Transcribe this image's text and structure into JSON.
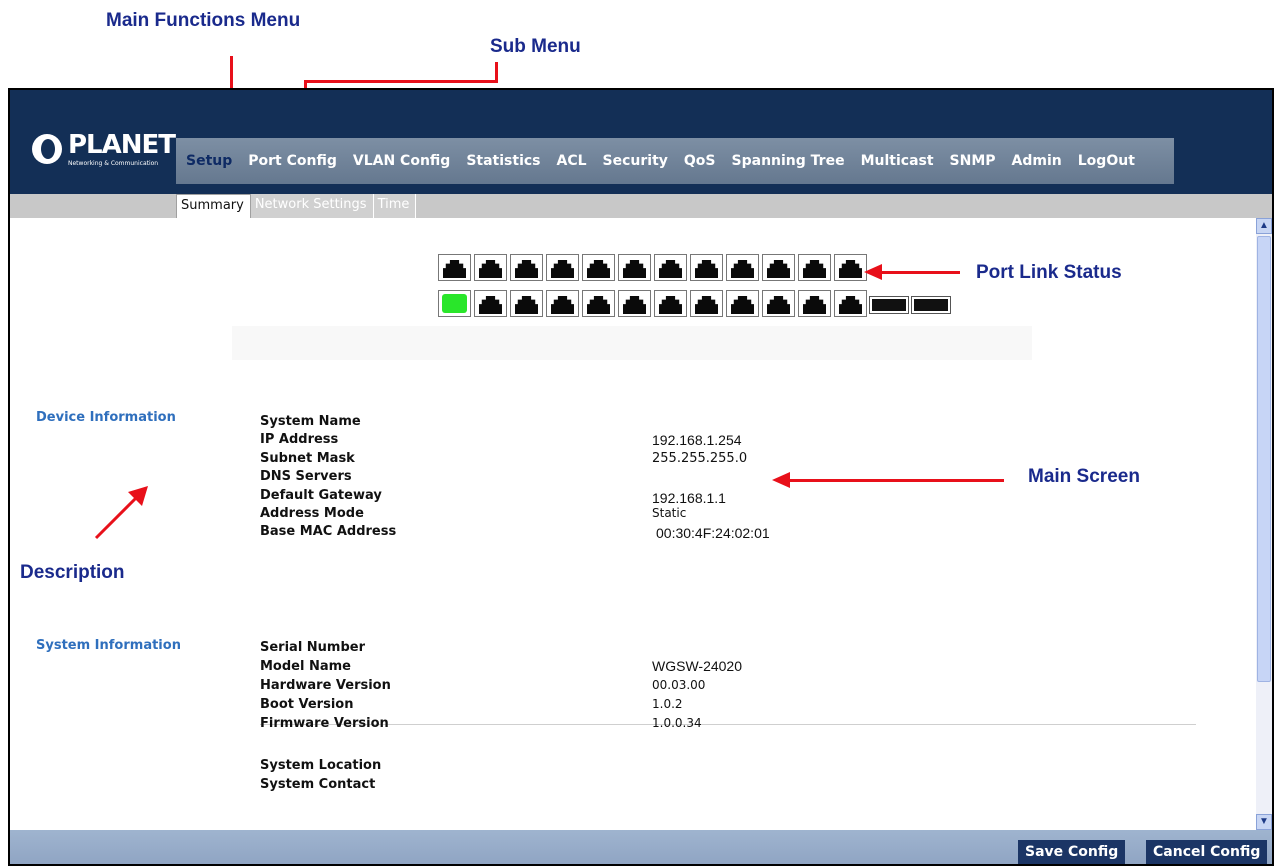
{
  "annotations": {
    "main_functions_menu": "Main Functions Menu",
    "sub_menu": "Sub Menu",
    "port_link_status": "Port Link Status",
    "main_screen": "Main Screen",
    "description": "Description"
  },
  "logo": {
    "name": "PLANET",
    "tagline": "Networking & Communication"
  },
  "main_menu": [
    "Setup",
    "Port Config",
    "VLAN Config",
    "Statistics",
    "ACL",
    "Security",
    "QoS",
    "Spanning Tree",
    "Multicast",
    "SNMP",
    "Admin",
    "LogOut"
  ],
  "main_menu_active": "Setup",
  "sub_menu": [
    "Summary",
    "Network Settings",
    "Time"
  ],
  "sub_menu_active": "Summary",
  "ports": {
    "top_row_count": 12,
    "bottom_row_count": 12,
    "sfp_count": 2,
    "link_up_port": "bottom row, port 1",
    "link_up_color": "#29e62a"
  },
  "device_information": {
    "title": "Device Information",
    "rows": [
      {
        "label": "System Name",
        "value": ""
      },
      {
        "label": "IP Address",
        "value": "192.168.1.254"
      },
      {
        "label": "Subnet Mask",
        "value": "255.255.255.0"
      },
      {
        "label": "DNS Servers",
        "value": ""
      },
      {
        "label": "Default Gateway",
        "value": "192.168.1.1"
      },
      {
        "label": "Address Mode",
        "value": "Static"
      },
      {
        "label": "Base MAC Address",
        "value": "00:30:4F:24:02:01"
      }
    ]
  },
  "system_information": {
    "title": "System Information",
    "rows": [
      {
        "label": "Serial Number",
        "value": ""
      },
      {
        "label": "Model Name",
        "value": "WGSW-24020"
      },
      {
        "label": "Hardware Version",
        "value": "00.03.00"
      },
      {
        "label": "Boot Version",
        "value": "1.0.2"
      },
      {
        "label": "Firmware Version",
        "value": "1.0.0.34"
      },
      {
        "label": "System Location",
        "value": ""
      },
      {
        "label": "System Contact",
        "value": ""
      }
    ]
  },
  "footer": {
    "save_label": "Save Config",
    "cancel_label": "Cancel Config"
  },
  "colors": {
    "header": "#132f56",
    "annotation_text": "#1a2a8c",
    "annotation_arrow": "#e8101a",
    "section_title": "#2f6fbd"
  }
}
